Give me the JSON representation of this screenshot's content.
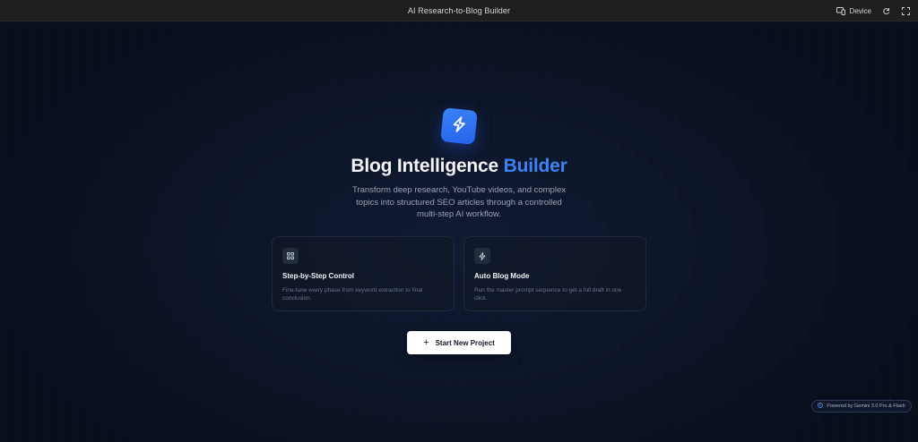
{
  "window": {
    "title": "AI Research-to-Blog Builder",
    "device_label": "Device"
  },
  "hero": {
    "title_main": "Blog Intelligence",
    "title_accent": "Builder",
    "subtitle": "Transform deep research, YouTube videos, and complex topics into structured SEO articles through a controlled multi-step AI workflow."
  },
  "cards": [
    {
      "icon": "grid-icon",
      "title": "Step-by-Step Control",
      "description": "Fine-tune every phase from keyword extraction to final conclusion."
    },
    {
      "icon": "lightning-icon",
      "title": "Auto Blog Mode",
      "description": "Run the master prompt sequence to get a full draft in one click."
    }
  ],
  "actions": {
    "start_label": "Start New Project"
  },
  "footer": {
    "powered_by": "Powered by Gemini 3.0 Pro & Flash"
  },
  "colors": {
    "accent": "#3b82f6",
    "background": "#0b1120",
    "topbar": "#1f1f1f"
  }
}
